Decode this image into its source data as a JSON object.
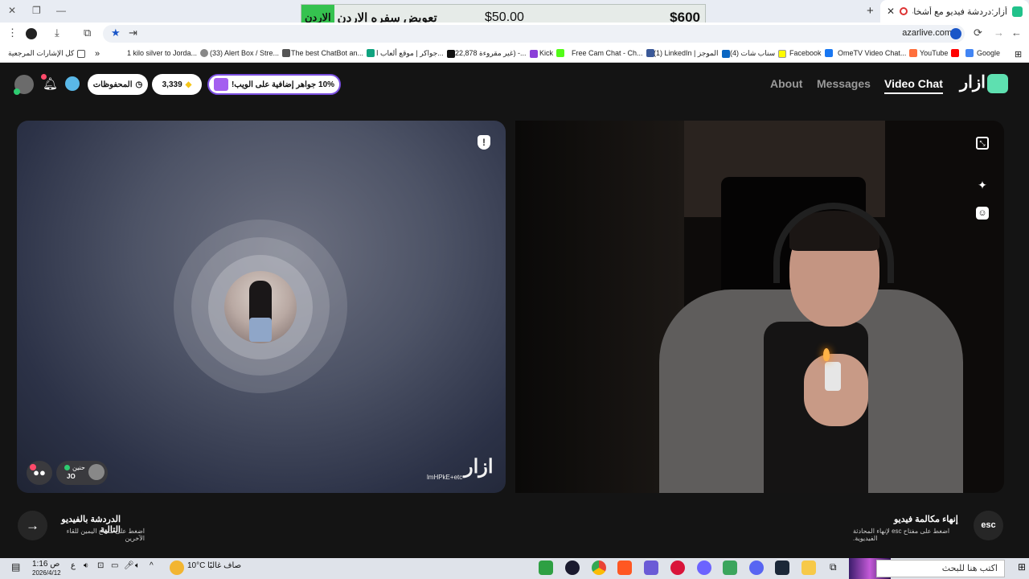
{
  "browser": {
    "tab_title": "أزار:دردشة فيديو مع أشخاص",
    "url": "azarlive.com",
    "bookmarks": [
      "Google",
      "YouTube",
      "OmeTV Video Chat...",
      "Facebook",
      "(4) سناب شات",
      "(1) LinkedIn | الموجز",
      "Free Cam Chat - Ch...",
      "Kick",
      "22,878 غير مقروءة) -...",
      "جواكر | موقع ألعاب ا...",
      "The best ChatBot an...",
      "(33) Alert Box / Stre...",
      "1 kilo silver to Jorda...",
      "كل الإشارات المرجعية"
    ],
    "bookmark_colors": [
      "#4285f4",
      "#ff0000",
      "#ff6f3c",
      "#1877f2",
      "#fffc00",
      "#0a66c2",
      "#3b5998",
      "#53fc18",
      "#d93025",
      "#111111",
      "#10a37f",
      "#555555",
      "#555555",
      "#333333"
    ]
  },
  "ad": {
    "label": "تعويض سفره الاردن",
    "price_1": "$50.00",
    "price_2": "$600"
  },
  "header": {
    "logo": "ازار",
    "nav": [
      "Video Chat",
      "Messages",
      "About"
    ],
    "promo": "10% جواهر إضافية على الويب!",
    "gems": "3,339",
    "saved": "المحفوظات"
  },
  "left_panel": {
    "watermark": "ازار",
    "session_id": "lmHPkE+etc",
    "partner_name": "حنين",
    "partner_country": "JO"
  },
  "controls": {
    "next_title": "الدردشة بالفيديو التالية",
    "next_sub": "اضغط على مفتاح اليمين للقاء الآخرين",
    "next_icon": "arrow-right-icon",
    "esc_label": "esc",
    "end_title": "إنهاء مكالمة فيديو",
    "end_sub": "اضغط على مفتاح esc لإنهاء المحادثة الفيديوية."
  },
  "taskbar": {
    "search_placeholder": "اكتب هنا للبحث",
    "weather": "صاف غالبًا",
    "temp": "10°C",
    "time": "1:16 ص",
    "date": "2026/4/12",
    "lang": "ع"
  }
}
